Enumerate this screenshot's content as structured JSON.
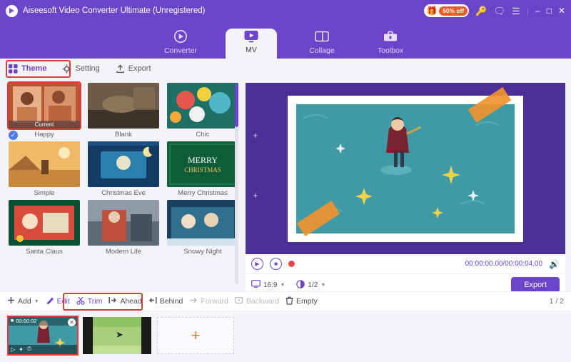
{
  "window": {
    "title": "Aiseesoft Video Converter Ultimate (Unregistered)",
    "logo_icon": "play-logo-icon",
    "promo": {
      "gift_icon": "gift-icon",
      "discount_label": "50% off"
    },
    "icons": [
      "key-icon",
      "message-icon",
      "menu-icon"
    ],
    "controls": {
      "minimize": "–",
      "maximize": "□",
      "close": "✕"
    }
  },
  "nav": {
    "items": [
      {
        "label": "Converter",
        "icon": "converter-icon",
        "active": false
      },
      {
        "label": "MV",
        "icon": "mv-icon",
        "active": true
      },
      {
        "label": "Collage",
        "icon": "collage-icon",
        "active": false
      },
      {
        "label": "Toolbox",
        "icon": "toolbox-icon",
        "active": false
      }
    ]
  },
  "subtabs": [
    {
      "label": "Theme",
      "icon": "grid-icon",
      "selected": true
    },
    {
      "label": "Setting",
      "icon": "gear-icon",
      "selected": false
    },
    {
      "label": "Export",
      "icon": "export-icon",
      "selected": false
    }
  ],
  "themes": [
    {
      "label": "Happy",
      "current_tag": "Current",
      "selected": true,
      "checked": true
    },
    {
      "label": "Blank",
      "current_tag": "",
      "selected": false,
      "checked": false
    },
    {
      "label": "Chic",
      "current_tag": "",
      "selected": false,
      "checked": false
    },
    {
      "label": "Simple",
      "current_tag": "",
      "selected": false,
      "checked": false
    },
    {
      "label": "Christmas Eve",
      "current_tag": "",
      "selected": false,
      "checked": false
    },
    {
      "label": "Merry Christmas",
      "current_tag": "",
      "selected": false,
      "checked": false
    },
    {
      "label": "Santa Claus",
      "current_tag": "",
      "selected": false,
      "checked": false
    },
    {
      "label": "Modern Life",
      "current_tag": "",
      "selected": false,
      "checked": false
    },
    {
      "label": "Snowy Night",
      "current_tag": "",
      "selected": false,
      "checked": false
    }
  ],
  "preview": {
    "play_icon": "play-icon",
    "stop_icon": "stop-icon",
    "record_icon": "record-dot-icon",
    "time": "00:00:00.00/00:00:04.00",
    "volume_icon": "volume-icon",
    "ratio": {
      "icon": "monitor-icon",
      "value": "16:9"
    },
    "quality": {
      "icon": "circle-half-icon",
      "value": "1/2"
    },
    "screen": {
      "icon": "screen-icon",
      "value": ""
    },
    "export_label": "Export"
  },
  "actionbar": {
    "buttons": [
      {
        "label": "Add",
        "icon": "plus-icon",
        "state": "normal",
        "caret": true
      },
      {
        "label": "Edit",
        "icon": "wand-icon",
        "state": "purple",
        "caret": false
      },
      {
        "label": "Trim",
        "icon": "scissors-icon",
        "state": "purple",
        "caret": false
      },
      {
        "label": "Ahead",
        "icon": "ahead-icon",
        "state": "normal",
        "caret": false
      },
      {
        "label": "Behind",
        "icon": "behind-icon",
        "state": "normal",
        "caret": false
      },
      {
        "label": "Forward",
        "icon": "forward-icon",
        "state": "disabled",
        "caret": false
      },
      {
        "label": "Backward",
        "icon": "backward-icon",
        "state": "disabled",
        "caret": false
      },
      {
        "label": "Empty",
        "icon": "trash-icon",
        "state": "normal",
        "caret": false
      }
    ],
    "page_indicator": "1 / 2"
  },
  "timeline": {
    "clips": [
      {
        "duration": "00:00:02",
        "selected": true,
        "close_icon": "close-icon",
        "tools": [
          "play-icon",
          "wand-icon",
          "clock-icon"
        ]
      },
      {
        "duration": "",
        "selected": false,
        "close_icon": "",
        "tools": []
      }
    ],
    "add_label": "+"
  },
  "colors": {
    "brand_purple": "#6b45c9",
    "highlight_red": "#e03a3a",
    "accent_orange": "#f0763a",
    "stage_purple": "#4b2f96",
    "teal": "#3f9aa6"
  }
}
